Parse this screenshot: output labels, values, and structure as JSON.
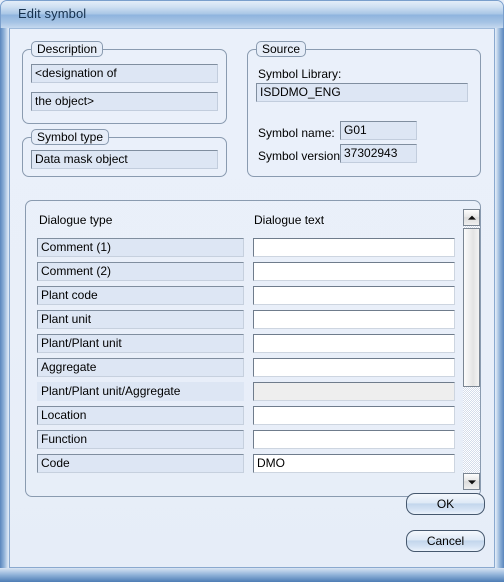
{
  "window": {
    "title": "Edit symbol"
  },
  "description_group": {
    "legend": "Description",
    "line1": "<designation of",
    "line2": "the object>"
  },
  "symbol_type_group": {
    "legend": "Symbol type",
    "value": "Data mask object"
  },
  "source_group": {
    "legend": "Source",
    "library_label": "Symbol Library:",
    "library_value": "ISDDMO_ENG",
    "name_label": "Symbol name:",
    "name_value": "G01",
    "version_label": "Symbol version:",
    "version_value": "37302943"
  },
  "table": {
    "headers": [
      "Dialogue type",
      "Dialogue text"
    ],
    "rows": [
      {
        "type": "Comment (1)",
        "text": "",
        "disabled": false,
        "label_borderless": false
      },
      {
        "type": "Comment (2)",
        "text": "",
        "disabled": false,
        "label_borderless": false
      },
      {
        "type": "Plant code",
        "text": "",
        "disabled": false,
        "label_borderless": false
      },
      {
        "type": "Plant unit",
        "text": "",
        "disabled": false,
        "label_borderless": false
      },
      {
        "type": "Plant/Plant unit",
        "text": "",
        "disabled": false,
        "label_borderless": false
      },
      {
        "type": "Aggregate",
        "text": "",
        "disabled": false,
        "label_borderless": false
      },
      {
        "type": "Plant/Plant unit/Aggregate",
        "text": "",
        "disabled": true,
        "label_borderless": true
      },
      {
        "type": "Location",
        "text": "",
        "disabled": false,
        "label_borderless": false
      },
      {
        "type": "Function",
        "text": "",
        "disabled": false,
        "label_borderless": false
      },
      {
        "type": "Code",
        "text": "DMO",
        "disabled": false,
        "label_borderless": false
      }
    ],
    "scrollbar": {
      "up_icon": "triangle-up-icon",
      "down_icon": "triangle-down-icon"
    }
  },
  "buttons": {
    "ok": "OK",
    "cancel": "Cancel"
  },
  "colors": {
    "titlebar_blue": "#8fb4de",
    "frame_blue": "#5a86bd",
    "client_bg": "#e8eef8",
    "field_readonly_bg": "#dde6f4",
    "field_edit_bg": "#ffffff",
    "field_disabled_bg": "#eeeeee"
  }
}
